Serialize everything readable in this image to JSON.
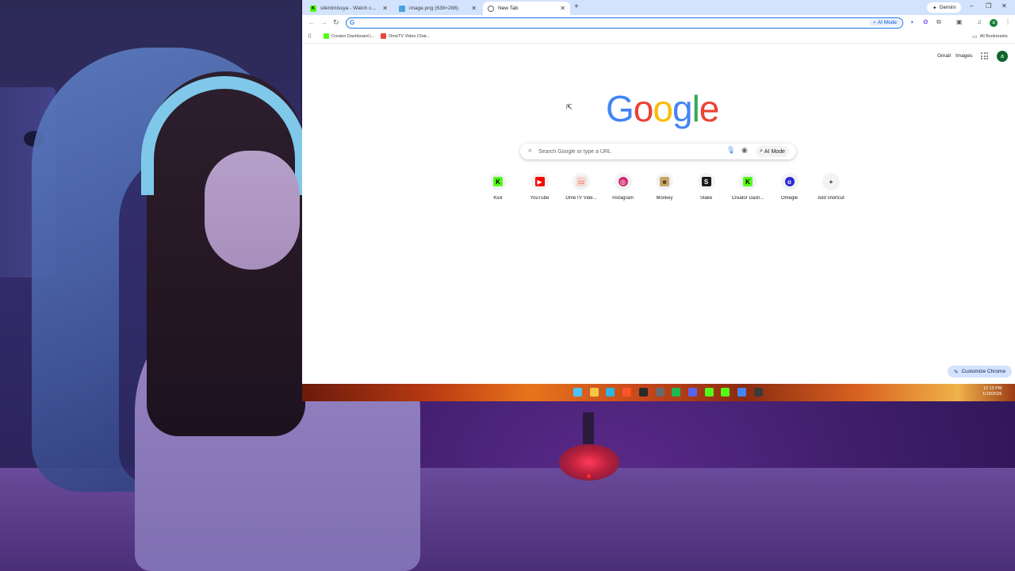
{
  "browser": {
    "tabs": [
      {
        "title": "silentmissya - Watch clips on K...",
        "favicon": "kick-icon",
        "favicon_color": "#53fc18",
        "active": false
      },
      {
        "title": "image.png (639×288)",
        "favicon": "image-icon",
        "favicon_color": "#4aa3df",
        "active": false
      },
      {
        "title": "New Tab",
        "favicon": "chrome-icon",
        "favicon_color": "#5f6368",
        "active": true
      }
    ],
    "new_tab_symbol": "+",
    "gemini_label": "Gemini",
    "window_controls": {
      "minimize": "–",
      "restore": "❐",
      "close": "✕"
    },
    "omnibox": {
      "value": "",
      "ai_mode_label": "AI Mode"
    },
    "bookmarks": [
      {
        "label": "Creator Dashboard |...",
        "favicon_color": "#53fc18"
      },
      {
        "label": "OmeTV Video Chat...",
        "favicon_color": "#e8453c"
      }
    ],
    "all_bookmarks_label": "All Bookmarks",
    "profile_initial": "a"
  },
  "newtab": {
    "links": {
      "gmail": "Gmail",
      "images": "Images"
    },
    "logo": [
      {
        "letter": "G",
        "color": "#4285f4"
      },
      {
        "letter": "o",
        "color": "#ea4335"
      },
      {
        "letter": "o",
        "color": "#fbbc05"
      },
      {
        "letter": "g",
        "color": "#4285f4"
      },
      {
        "letter": "l",
        "color": "#34a853"
      },
      {
        "letter": "e",
        "color": "#ea4335"
      }
    ],
    "search": {
      "placeholder": "Search Google or type a URL",
      "ai_mode_label": "AI Mode"
    },
    "shortcuts": [
      {
        "label": "Kick",
        "icon": "kick-icon",
        "glyph": "K",
        "bg": "#53fc18",
        "fg": "#000000"
      },
      {
        "label": "YouTube",
        "icon": "youtube-icon",
        "glyph": "▶",
        "bg": "#ff0000",
        "fg": "#ffffff"
      },
      {
        "label": "OmeTV Vide...",
        "icon": "ometv-icon",
        "glyph": "▭",
        "bg": "#f6d6cf",
        "fg": "#e8453c"
      },
      {
        "label": "Instagram",
        "icon": "instagram-icon",
        "glyph": "◎",
        "bg": "#d62976",
        "fg": "#ffffff"
      },
      {
        "label": "Monkey",
        "icon": "monkey-icon",
        "glyph": "☻",
        "bg": "#c9a46a",
        "fg": "#5a3a1a"
      },
      {
        "label": "Stake",
        "icon": "stake-icon",
        "glyph": "S",
        "bg": "#1a1a1a",
        "fg": "#ffffff"
      },
      {
        "label": "Creator Dash...",
        "icon": "kick-icon",
        "glyph": "K",
        "bg": "#53fc18",
        "fg": "#000000"
      },
      {
        "label": "Omegle",
        "icon": "omegle-icon",
        "glyph": "o",
        "bg": "#2b2bd6",
        "fg": "#ffffff"
      },
      {
        "label": "Add shortcut",
        "icon": "plus-icon",
        "glyph": "+",
        "bg": "#f1f3f4",
        "fg": "#202124"
      }
    ],
    "customize_label": "Customize Chrome"
  },
  "taskbar": {
    "apps": [
      {
        "icon": "windows-start-icon",
        "color": "#4cc2ff"
      },
      {
        "icon": "file-explorer-icon",
        "color": "#f3c64a"
      },
      {
        "icon": "edge-icon",
        "color": "#2fb3e0"
      },
      {
        "icon": "brave-icon",
        "color": "#fb542b"
      },
      {
        "icon": "terminal-icon",
        "color": "#2a2a2a"
      },
      {
        "icon": "app-icon",
        "color": "#6a6a6a"
      },
      {
        "icon": "spotify-icon",
        "color": "#1db954"
      },
      {
        "icon": "discord-icon",
        "color": "#5865f2"
      },
      {
        "icon": "kick-icon",
        "color": "#53fc18"
      },
      {
        "icon": "kick-app-icon",
        "color": "#53fc18"
      },
      {
        "icon": "chrome-icon",
        "color": "#4285f4"
      },
      {
        "icon": "obs-icon",
        "color": "#3a3a3a"
      }
    ],
    "time": "12:13 PM",
    "date": "1/19/2026"
  }
}
